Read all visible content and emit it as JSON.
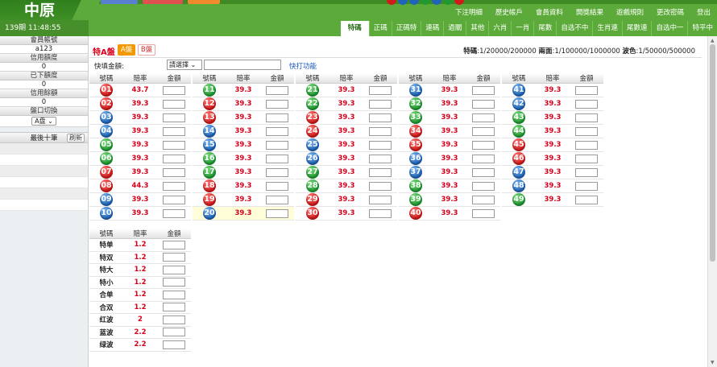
{
  "header": {
    "logo": "中原",
    "time": "139期 11:48:55",
    "nav": [
      "下注明細",
      "歷史帳戶",
      "會員資料",
      "開獎結果",
      "遊戲規則",
      "更改密碼",
      "登出"
    ],
    "tabs": [
      {
        "label": "特碼",
        "active": true
      },
      {
        "label": "正碼",
        "active": false
      },
      {
        "label": "正碼特",
        "active": false
      },
      {
        "label": "連碼",
        "active": false
      },
      {
        "label": "過關",
        "active": false
      },
      {
        "label": "其他",
        "active": false
      },
      {
        "label": "六肖",
        "active": false
      },
      {
        "label": "一肖",
        "active": false
      },
      {
        "label": "尾數",
        "active": false
      },
      {
        "label": "自选不中",
        "active": false
      },
      {
        "label": "生肖連",
        "active": false
      },
      {
        "label": "尾數連",
        "active": false
      },
      {
        "label": "自选中一",
        "active": false
      },
      {
        "label": "特平中",
        "active": false
      }
    ],
    "colors": {
      "header_green": "#5cab3a",
      "accent_red": "#d9001b",
      "accent_orange": "#f39800"
    }
  },
  "sidebar": {
    "member_label": "會員帳號",
    "member_value": "a123",
    "credit_label": "信用額度",
    "credit_value": "0",
    "bet_label": "已下額度",
    "bet_value": "0",
    "balance_label": "信用餘額",
    "balance_value": "0",
    "switch_label": "盤口切換",
    "switch_value": "A盘",
    "recent_label": "最後十筆",
    "refresh_label": "刷新"
  },
  "main": {
    "title": "特A盤",
    "a_label": "A盤",
    "b_label": "B盤",
    "limits": {
      "k1": "特碼",
      "v1": "1/20000/200000",
      "k2": "兩面",
      "v2": "1/100000/1000000",
      "k3": "波色",
      "v3": "1/50000/500000"
    },
    "quick_label": "快填金額:",
    "quick_select": "請選擇",
    "quick_link": "快打功能",
    "headers": {
      "num": "號碼",
      "odds": "賠率",
      "amount": "金額"
    },
    "numbers": [
      {
        "n": "01",
        "c": "red",
        "o": "43.7"
      },
      {
        "n": "02",
        "c": "red",
        "o": "39.3"
      },
      {
        "n": "03",
        "c": "blue",
        "o": "39.3"
      },
      {
        "n": "04",
        "c": "blue",
        "o": "39.3"
      },
      {
        "n": "05",
        "c": "green",
        "o": "39.3"
      },
      {
        "n": "06",
        "c": "green",
        "o": "39.3"
      },
      {
        "n": "07",
        "c": "red",
        "o": "39.3"
      },
      {
        "n": "08",
        "c": "red",
        "o": "44.3"
      },
      {
        "n": "09",
        "c": "blue",
        "o": "39.3"
      },
      {
        "n": "10",
        "c": "blue",
        "o": "39.3"
      },
      {
        "n": "11",
        "c": "green",
        "o": "39.3"
      },
      {
        "n": "12",
        "c": "red",
        "o": "39.3"
      },
      {
        "n": "13",
        "c": "red",
        "o": "39.3"
      },
      {
        "n": "14",
        "c": "blue",
        "o": "39.3"
      },
      {
        "n": "15",
        "c": "blue",
        "o": "39.3"
      },
      {
        "n": "16",
        "c": "green",
        "o": "39.3"
      },
      {
        "n": "17",
        "c": "green",
        "o": "39.3"
      },
      {
        "n": "18",
        "c": "red",
        "o": "39.3"
      },
      {
        "n": "19",
        "c": "red",
        "o": "39.3"
      },
      {
        "n": "20",
        "c": "blue",
        "o": "39.3"
      },
      {
        "n": "21",
        "c": "green",
        "o": "39.3"
      },
      {
        "n": "22",
        "c": "green",
        "o": "39.3"
      },
      {
        "n": "23",
        "c": "red",
        "o": "39.3"
      },
      {
        "n": "24",
        "c": "red",
        "o": "39.3"
      },
      {
        "n": "25",
        "c": "blue",
        "o": "39.3"
      },
      {
        "n": "26",
        "c": "blue",
        "o": "39.3"
      },
      {
        "n": "27",
        "c": "green",
        "o": "39.3"
      },
      {
        "n": "28",
        "c": "green",
        "o": "39.3"
      },
      {
        "n": "29",
        "c": "red",
        "o": "39.3"
      },
      {
        "n": "30",
        "c": "red",
        "o": "39.3"
      },
      {
        "n": "31",
        "c": "blue",
        "o": "39.3"
      },
      {
        "n": "32",
        "c": "green",
        "o": "39.3"
      },
      {
        "n": "33",
        "c": "green",
        "o": "39.3"
      },
      {
        "n": "34",
        "c": "red",
        "o": "39.3"
      },
      {
        "n": "35",
        "c": "red",
        "o": "39.3"
      },
      {
        "n": "36",
        "c": "blue",
        "o": "39.3"
      },
      {
        "n": "37",
        "c": "blue",
        "o": "39.3"
      },
      {
        "n": "38",
        "c": "green",
        "o": "39.3"
      },
      {
        "n": "39",
        "c": "green",
        "o": "39.3"
      },
      {
        "n": "40",
        "c": "red",
        "o": "39.3"
      },
      {
        "n": "41",
        "c": "blue",
        "o": "39.3"
      },
      {
        "n": "42",
        "c": "blue",
        "o": "39.3"
      },
      {
        "n": "43",
        "c": "green",
        "o": "39.3"
      },
      {
        "n": "44",
        "c": "green",
        "o": "39.3"
      },
      {
        "n": "45",
        "c": "red",
        "o": "39.3"
      },
      {
        "n": "46",
        "c": "red",
        "o": "39.3"
      },
      {
        "n": "47",
        "c": "blue",
        "o": "39.3"
      },
      {
        "n": "48",
        "c": "blue",
        "o": "39.3"
      },
      {
        "n": "49",
        "c": "green",
        "o": "39.3"
      }
    ],
    "specials": [
      {
        "name": "特单",
        "o": "1.2"
      },
      {
        "name": "特双",
        "o": "1.2"
      },
      {
        "name": "特大",
        "o": "1.2"
      },
      {
        "name": "特小",
        "o": "1.2"
      },
      {
        "name": "合单",
        "o": "1.2"
      },
      {
        "name": "合双",
        "o": "1.2"
      },
      {
        "name": "红波",
        "o": "2"
      },
      {
        "name": "蓝波",
        "o": "2.2"
      },
      {
        "name": "绿波",
        "o": "2.2"
      }
    ]
  }
}
